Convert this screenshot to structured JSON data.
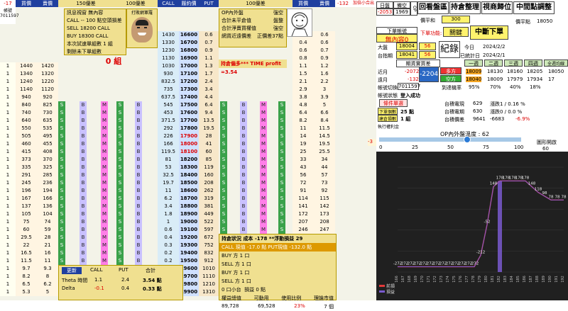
{
  "ladder": {
    "headers": {
      "left_offset": "-17",
      "left_buy": "買價",
      "left_sell": "賣價",
      "call_grid": "150優差",
      "call_strike_label": "100優差",
      "call": "CALL",
      "strike": "履約價",
      "put": "PUT",
      "put_grid": "100優差",
      "buy2": "買價",
      "sell2": "賣價",
      "right_offset": "-132",
      "note": "加倍小合出"
    },
    "account": {
      "label": "帳號",
      "id": "7011597"
    },
    "info_left": [
      "訊息視窗  無內容",
      "CALL -- 100 點空頭損差",
      "SELL  18200  CALL",
      "BUY   18300  CALL",
      "本次試速單組數 1 組",
      "剩餘未下單組數"
    ],
    "zero_group": "0 組",
    "info_right": [
      "OP內外盤",
      "合計未平倉值",
      "合計淨賣買權值",
      "網貨近遠價差"
    ],
    "info_right_vals": [
      "強空",
      "盤整",
      "強空",
      "正價差37點"
    ],
    "status_line": "持倉偏多*** TIME profit =3.54",
    "avatar_label": "打敗網軍羅",
    "strikes": [
      "16600",
      "16700",
      "16800",
      "16900",
      "17000",
      "17100",
      "17200",
      "17300",
      "17400",
      "17500",
      "17600",
      "17700",
      "17800",
      "17900",
      "18000",
      "18100",
      "18200",
      "18300",
      "18400",
      "18500",
      "18600",
      "18700",
      "18800",
      "18900",
      "19000",
      "19100",
      "19200",
      "19300",
      "19400",
      "19500",
      "19600",
      "19700",
      "19800",
      "19900"
    ],
    "call_prices": [
      "1430",
      "1330",
      "1230",
      "1130",
      "1030",
      "930",
      "832.5",
      "735",
      "637.5",
      "545",
      "453",
      "371.5",
      "292",
      "226",
      "166",
      "119.5",
      "81",
      "53",
      "32.5",
      "19.7",
      "11",
      "6.2",
      "3.4",
      "1.8",
      "1",
      "0.6",
      "0.4",
      "0.3",
      "0.2",
      "0.2",
      "0.1",
      "0.1",
      "0.1",
      "0.1"
    ],
    "put_prices": [
      "0.6",
      "0.7",
      "0.9",
      "1.1",
      "1.3",
      "1.7",
      "2.4",
      "3.4",
      "4.4",
      "6.4",
      "9.4",
      "13.5",
      "19.5",
      "28",
      "41",
      "60",
      "85",
      "119",
      "160",
      "208",
      "262",
      "319",
      "381",
      "449",
      "522",
      "597",
      "672",
      "752",
      "832",
      "912",
      "1010",
      "1110",
      "1210",
      "1310"
    ],
    "left_buy": [
      "1440",
      "1340",
      "1240",
      "1140",
      "940",
      "840",
      "740",
      "640",
      "550",
      "505",
      "460",
      "415",
      "373",
      "335",
      "291",
      "245",
      "196",
      "167",
      "137",
      "105",
      "75",
      "60",
      "29.5",
      "22",
      "16.5",
      "11.5",
      "9.7",
      "8.2",
      "6.5",
      "5.3"
    ],
    "left_sell": [
      "1420",
      "1320",
      "1220",
      "1120",
      "920",
      "825",
      "730",
      "635",
      "535",
      "495",
      "455",
      "408",
      "370",
      "325",
      "285",
      "236",
      "194",
      "166",
      "136",
      "104",
      "74",
      "59",
      "28",
      "21",
      "16",
      "11",
      "9.3",
      "8",
      "6.2",
      "5"
    ],
    "row_nums": [
      "1",
      "1",
      "1",
      "1",
      "1",
      "1",
      "1",
      "1",
      "1",
      "1",
      "1",
      "1",
      "1",
      "1",
      "1",
      "1",
      "1",
      "1",
      "1",
      "1",
      "1",
      "1",
      "1",
      "1",
      "1",
      "1",
      "1",
      "1",
      "1",
      "1"
    ],
    "s_label": "S",
    "b_label": "B",
    "m_label": "M",
    "right_buy": [
      "0.5",
      "0.4",
      "0.6",
      "0.8",
      "1.1",
      "1.5",
      "2.1",
      "2.9",
      "3.8",
      "4.8",
      "6.4",
      "8.2",
      "11",
      "14",
      "19",
      "25",
      "33",
      "43",
      "56",
      "72",
      "91",
      "114",
      "141",
      "172",
      "207",
      "246",
      "290",
      "338",
      "390",
      "446",
      "505",
      "568",
      "615",
      "660"
    ],
    "right_sell": [
      "0.6",
      "0.6",
      "0.7",
      "0.9",
      "1.2",
      "1.6",
      "2.2",
      "3",
      "3.9",
      "5",
      "6.6",
      "8.4",
      "11.5",
      "14.5",
      "19.5",
      "25.5",
      "34",
      "44",
      "57",
      "73",
      "92",
      "115",
      "142",
      "173",
      "208",
      "247",
      "291",
      "339",
      "391",
      "447",
      "506",
      "569",
      "620",
      "680"
    ]
  },
  "bottom_block": {
    "refresh": "更新",
    "call": "CALL",
    "put": "PUT",
    "total": "合計",
    "theta_label": "Theta 時間",
    "theta_call": "1.1",
    "theta_put": "2.4",
    "theta_total": "3.54 點",
    "delta_label": "Delta",
    "delta_call": "-0.1",
    "delta_put": "0.4",
    "delta_total": "0.33 點",
    "status": "持倉狀況",
    "cost": "成本 -178 **浮動損益 29",
    "call_put": "CALL 現值 -17.0 點  PUT現值 -132.0 點",
    "buy_sell": [
      "BUY 方",
      "SELL 方",
      "BUY 方",
      "SELL 方"
    ],
    "bs_vals": [
      "1 口",
      "1 口",
      "1 口",
      "1 口"
    ],
    "open_interest": "0 口小台",
    "pnl": "損益 0 點",
    "margin_labels": [
      "權益總值",
      "可動用",
      "使用比例",
      "理論市值"
    ],
    "margin_vals": [
      "89,728",
      "69,528",
      "23%",
      "7 個"
    ]
  },
  "panel": {
    "day_label": "日盤",
    "empty_label": "備空",
    "day_val": "-2053",
    "night_val": "1969",
    "avg_label": "價平和",
    "avg_val": "300",
    "buttons": [
      "回看盤區",
      "持倉整理",
      "視商歸位",
      "中間點調整"
    ],
    "mid_label": "價平點",
    "mid_val": "18050",
    "option_label": "下單帳號",
    "option_value": "無內容0",
    "function_label": "下單功能:",
    "function_val": "關鍵",
    "mid_order": "中斷下單",
    "big_label": "大盤",
    "big_val": "18004",
    "big_chg": "56",
    "tx_label": "台指期",
    "tx_val": "18041",
    "tx_chg": "56",
    "memo": "紀錄",
    "today_label": "今日",
    "today_date": "2024/2/2",
    "expire_label": "已統計日",
    "expire_date": "2024/2/1",
    "expiry_header": "期貨實買差",
    "cols": [
      "一週",
      "二週",
      "三週",
      "四週",
      "全週均線"
    ],
    "row1_label": "近月",
    "row1_val": "-2072",
    "row1_tag": "多方",
    "row1_vals": [
      "18009",
      "18130",
      "18160",
      "18205",
      "18050"
    ],
    "row2_label": "遠月",
    "row2_val": "-132",
    "row2_tag": "空方",
    "row2_vals": [
      "18040",
      "18009",
      "17979",
      "17934",
      "17"
    ],
    "big_box": "-2204",
    "acct_label": "帳號切換",
    "acct_val": "7011597",
    "rate_label": "到達機率",
    "rates": [
      "95%",
      "70%",
      "40%",
      "18%"
    ],
    "conn_label": "帳號狀態",
    "conn_val": "登入成功",
    "auto": "條件單選",
    "auto_row1": "下單個數",
    "auto_row1_val": "25 點",
    "auto_row2": "建倉損數",
    "auto_row2_val": "1 組",
    "tx_info": [
      {
        "label": "台積電現",
        "v1": "629",
        "v2": "漲跌1 / 0.16 %"
      },
      {
        "label": "台積電期",
        "v1": "630",
        "v2": "漲跌0 / 0.0 %"
      },
      {
        "label": "台積價差",
        "v1": "9641",
        "v2": "-6683",
        "v3": "-6.9%"
      }
    ],
    "exec_label": "執行權利金",
    "op_temp": "OP內外盤溫度 : 62",
    "slider_ticks": [
      "0",
      "25",
      "50",
      "75",
      "100"
    ],
    "slider_value": 62,
    "slider_right_label": "圖形開啟",
    "slider_right_val": "60",
    "offset_left": "-3",
    "offset_right": "-3"
  },
  "chart_data": {
    "type": "line",
    "title": "",
    "x": [
      16600,
      16700,
      16800,
      16900,
      17000,
      17100,
      17200,
      17300,
      17400,
      17500,
      17600,
      17700,
      17800,
      17900,
      18000,
      18100,
      18200,
      18300,
      18400,
      18500,
      18600,
      18700,
      18800,
      18900,
      19000,
      19100,
      19200
    ],
    "series": [
      {
        "name": "前損",
        "values": [
          -272,
          -272,
          -272,
          -272,
          -272,
          -272,
          -272,
          -272,
          -272,
          -272,
          -272,
          -272,
          -272,
          -212,
          -52,
          148,
          178,
          178,
          178,
          178,
          178,
          148,
          118,
          98,
          78,
          78,
          78
        ]
      },
      {
        "name": "損益",
        "values": [
          -272,
          -272,
          -272,
          -272,
          -272,
          -272,
          -272,
          -272,
          -272,
          -272,
          -272,
          -272,
          -272,
          -212,
          -52,
          148,
          178,
          178,
          178,
          178,
          178,
          148,
          118,
          98,
          78,
          78,
          78
        ]
      }
    ],
    "point_labels": [
      "-272",
      "-272",
      "-272",
      "-272",
      "-272",
      "-272",
      "-272",
      "-272",
      "-272",
      "-272",
      "-272",
      "-272",
      "-272",
      "-212",
      "-52",
      "148",
      "178",
      "178",
      "178",
      "178",
      "178",
      "148",
      "118",
      "98",
      "78",
      "78",
      "78"
    ],
    "ylim": [
      -300,
      250
    ],
    "legend": "bottom-left",
    "colors": [
      "#e23a3a",
      "#7a5ad0"
    ]
  }
}
